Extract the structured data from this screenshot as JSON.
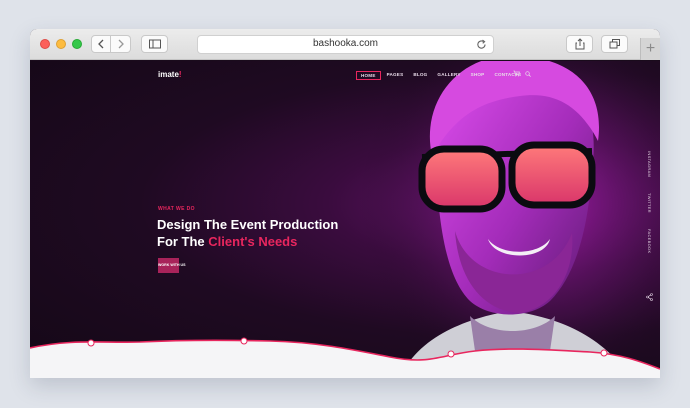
{
  "browser": {
    "url": "bashooka.com",
    "new_tab_label": "+"
  },
  "site": {
    "logo": "imate",
    "logo_dot": "!",
    "nav": [
      {
        "label": "HOME",
        "active": true
      },
      {
        "label": "PAGES",
        "active": false
      },
      {
        "label": "BLOG",
        "active": false
      },
      {
        "label": "GALLERY",
        "active": false
      },
      {
        "label": "SHOP",
        "active": false
      },
      {
        "label": "CONTACTS",
        "active": false
      }
    ],
    "hero": {
      "eyebrow": "WHAT WE DO",
      "headline_line1": "Design The Event Production",
      "headline_line2_prefix": "For The ",
      "headline_line2_highlight": "Client's Needs",
      "cta_label": "WORK WITH US"
    },
    "social": [
      "INSTAGRAM",
      "TWITTER",
      "FACEBOOK"
    ],
    "colors": {
      "accent": "#e8265e",
      "cta": "#a8235a",
      "background": "#1a0b1c"
    }
  }
}
